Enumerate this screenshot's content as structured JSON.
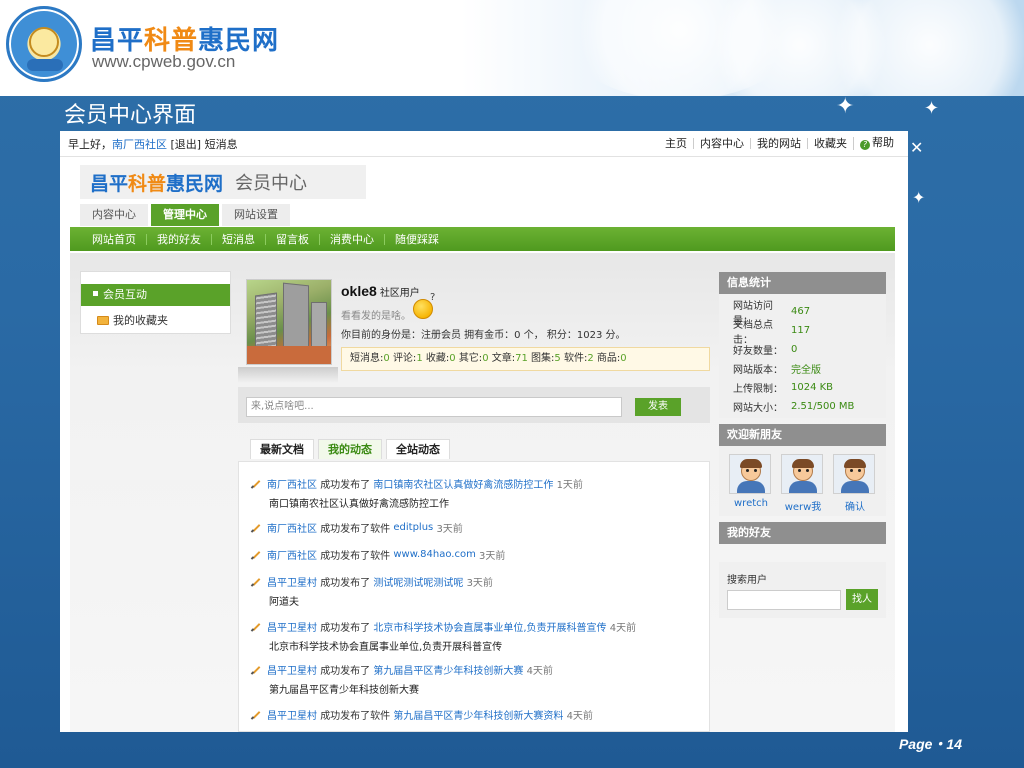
{
  "slide": {
    "brand": {
      "part1": "昌平",
      "part2": "科普",
      "part3": "惠民网",
      "url": "www.cpweb.gov.cn",
      "seal_text": "cpweb"
    },
    "title": "会员中心界面",
    "page": "Page・14"
  },
  "topbar": {
    "greeting": "早上好，",
    "user_link": "南厂西社区",
    "logout": "[退出]",
    "messages": "短消息",
    "links": [
      "主页",
      "内容中心",
      "我的网站",
      "收藏夹"
    ],
    "help": "帮助"
  },
  "site_logo": {
    "part1": "昌平",
    "part2": "科普",
    "part3": "惠民网",
    "sub": "会员中心"
  },
  "tabs": [
    {
      "label": "内容中心",
      "active": false
    },
    {
      "label": "管理中心",
      "active": true
    },
    {
      "label": "网站设置",
      "active": false
    }
  ],
  "subnav": [
    "网站首页",
    "我的好友",
    "短消息",
    "留言板",
    "消费中心",
    "随便踩踩"
  ],
  "left_menu": {
    "active": "会员互动",
    "item": "我的收藏夹"
  },
  "profile": {
    "username": "okle8",
    "role": "社区用户",
    "status": "看看发的是啥。",
    "identity": "你目前的身份是：注册会员 拥有金币：0 个， 积分：1023 分。",
    "stats": [
      {
        "label": "短消息:",
        "value": "0"
      },
      {
        "label": "评论:",
        "value": "1"
      },
      {
        "label": "收藏:",
        "value": "0"
      },
      {
        "label": "其它:",
        "value": "0"
      },
      {
        "label": "文章:",
        "value": "71"
      },
      {
        "label": "图集:",
        "value": "5"
      },
      {
        "label": "软件:",
        "value": "2"
      },
      {
        "label": "商品:",
        "value": "0"
      }
    ]
  },
  "post": {
    "placeholder": "来,说点啥吧...",
    "button": "发表"
  },
  "feed_tabs": [
    {
      "label": "最新文档",
      "active": false
    },
    {
      "label": "我的动态",
      "active": true
    },
    {
      "label": "全站动态",
      "active": false
    }
  ],
  "feed": [
    {
      "user": "南厂西社区",
      "action": "成功发布了",
      "target": "南口镇南农社区认真做好禽流感防控工作",
      "time": "1天前",
      "detail": "南口镇南农社区认真做好禽流感防控工作"
    },
    {
      "user": "南厂西社区",
      "action": "成功发布了软件",
      "target": "editplus",
      "time": "3天前",
      "detail": ""
    },
    {
      "user": "南厂西社区",
      "action": "成功发布了软件",
      "target": "www.84hao.com",
      "time": "3天前",
      "detail": ""
    },
    {
      "user": "昌平卫星村",
      "action": "成功发布了",
      "target": "测试呢测试呢测试呢",
      "time": "3天前",
      "detail": "阿道夫"
    },
    {
      "user": "昌平卫星村",
      "action": "成功发布了",
      "target": "北京市科学技术协会直属事业单位,负责开展科普宣传",
      "time": "4天前",
      "detail": "北京市科学技术协会直属事业单位,负责开展科普宣传"
    },
    {
      "user": "昌平卫星村",
      "action": "成功发布了",
      "target": "第九届昌平区青少年科技创新大赛",
      "time": "4天前",
      "detail": "第九届昌平区青少年科技创新大赛"
    },
    {
      "user": "昌平卫星村",
      "action": "成功发布了软件",
      "target": "第九届昌平区青少年科技创新大赛资料",
      "time": "4天前",
      "detail": ""
    }
  ],
  "info": {
    "title": "信息统计",
    "rows": [
      {
        "k": "网站访问量：",
        "v": "467"
      },
      {
        "k": "文档总点击：",
        "v": "117"
      },
      {
        "k": "好友数量：",
        "v": "0"
      },
      {
        "k": "网站版本：",
        "v": "完全版"
      },
      {
        "k": "上传限制：",
        "v": "1024 KB"
      },
      {
        "k": "网站大小：",
        "v": "2.51/500 MB"
      }
    ]
  },
  "new_friends": {
    "title": "欢迎新朋友",
    "list": [
      "wretch",
      "werw我",
      "确认"
    ]
  },
  "my_friends": {
    "title": "我的好友"
  },
  "search": {
    "label": "搜索用户",
    "button": "找人"
  },
  "colors": {
    "green": "#5aa229",
    "link_blue": "#1f6fc8",
    "brand_orange": "#f08a15"
  }
}
